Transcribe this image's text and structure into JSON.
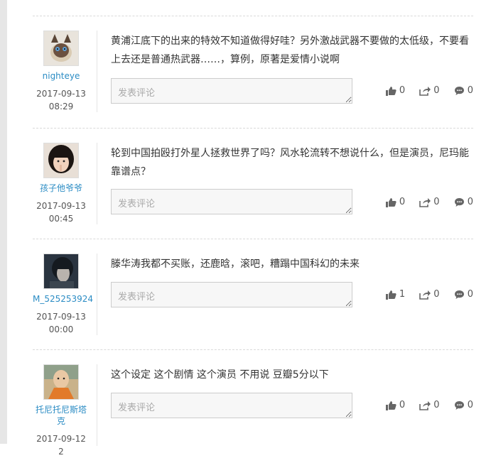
{
  "comments": [
    {
      "username": "nighteye",
      "time": "2017-09-13 08:29",
      "text": "黄浦江底下的出来的特效不知道做得好哇？另外激战武器不要做的太低级，不要看上去还是普通热武器……，算例，原著是爱情小说啊",
      "reply_placeholder": "发表评论",
      "likes": "0",
      "shares": "0",
      "replies": "0"
    },
    {
      "username": "孩子他爷爷",
      "time": "2017-09-13 00:45",
      "text": "轮到中国拍殴打外星人拯救世界了吗？风水轮流转不想说什么，但是演员，尼玛能靠谱点？",
      "reply_placeholder": "发表评论",
      "likes": "0",
      "shares": "0",
      "replies": "0"
    },
    {
      "username": "M_525253924",
      "time": "2017-09-13 00:00",
      "text": "滕华涛我都不买账，还鹿晗，滚吧，糟蹋中国科幻的未来",
      "reply_placeholder": "发表评论",
      "likes": "1",
      "shares": "0",
      "replies": "0"
    },
    {
      "username": "托尼托尼斯塔克",
      "time": "2017-09-12 2",
      "text": "这个设定 这个剧情 这个演员 不用说 豆瓣5分以下",
      "reply_placeholder": "发表评论",
      "likes": "0",
      "shares": "0",
      "replies": "0"
    }
  ],
  "colors": {
    "username": "#2b8cc4",
    "text": "#333333",
    "icon": "#666666"
  },
  "icons": [
    "thumbs-up-icon",
    "share-icon",
    "comment-bubble-icon"
  ]
}
